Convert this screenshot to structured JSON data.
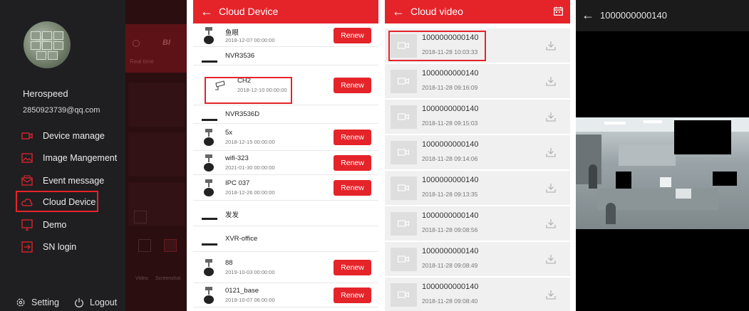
{
  "drawer": {
    "user_name": "Herospeed",
    "email": "2850923739@qq.com",
    "items": [
      {
        "label": "Device manage",
        "icon": "camera-icon"
      },
      {
        "label": "Image Mangement",
        "icon": "image-icon"
      },
      {
        "label": "Event message",
        "icon": "mail-icon"
      },
      {
        "label": "Cloud Device",
        "icon": "cloud-icon"
      },
      {
        "label": "Demo",
        "icon": "demo-icon"
      },
      {
        "label": "SN login",
        "icon": "sn-login-icon"
      }
    ],
    "setting_label": "Setting",
    "logout_label": "Logout",
    "bg_tab_label": "Real time",
    "bg_logo": "BI",
    "bg_video_label": "Video",
    "bg_screenshot_label": "Screenshot",
    "accent_color": "#e5242a"
  },
  "cloud_device": {
    "title": "Cloud Device",
    "renew_label": "Renew",
    "devices": [
      {
        "name": "鱼眼",
        "date": "2018-12-07 00:00:00",
        "type": "camera",
        "renew": true
      },
      {
        "name": "NVR3536",
        "date": "",
        "type": "nvr",
        "renew": false
      },
      {
        "name": "CH2",
        "date": "2018-12-10 00:00:00",
        "type": "channel",
        "renew": true
      },
      {
        "name": "NVR3536D",
        "date": "",
        "type": "nvr",
        "renew": false
      },
      {
        "name": "5x",
        "date": "2018-12-15 00:00:00",
        "type": "camera",
        "renew": true
      },
      {
        "name": "wifi-323",
        "date": "2021-01-30 00:00:00",
        "type": "camera",
        "renew": true
      },
      {
        "name": "IPC 037",
        "date": "2018-12-26 00:00:00",
        "type": "camera",
        "renew": true
      },
      {
        "name": "发发",
        "date": "",
        "type": "nvr",
        "renew": false
      },
      {
        "name": "XVR-office",
        "date": "",
        "type": "nvr",
        "renew": false
      },
      {
        "name": "88",
        "date": "2019-10-03 00:00:00",
        "type": "camera",
        "renew": true
      },
      {
        "name": "0121_base",
        "date": "2019-10-07 06:00:00",
        "type": "camera",
        "renew": true
      }
    ]
  },
  "cloud_video": {
    "title": "Cloud video",
    "videos": [
      {
        "name": "1000000000140",
        "date": "2018-11-28 10:03:33"
      },
      {
        "name": "1000000000140",
        "date": "2018-11-28 09:16:09"
      },
      {
        "name": "1000000000140",
        "date": "2018-11-28 09:15:03"
      },
      {
        "name": "1000000000140",
        "date": "2018-11-28 09:14:06"
      },
      {
        "name": "1000000000140",
        "date": "2018-11-28 09:13:35"
      },
      {
        "name": "1000000000140",
        "date": "2018-11-28 09:08:56"
      },
      {
        "name": "1000000000140",
        "date": "2018-11-28 09:08:49"
      },
      {
        "name": "1000000000140",
        "date": "2018-11-28 09:08:40"
      }
    ]
  },
  "player": {
    "title": "1000000000140"
  }
}
